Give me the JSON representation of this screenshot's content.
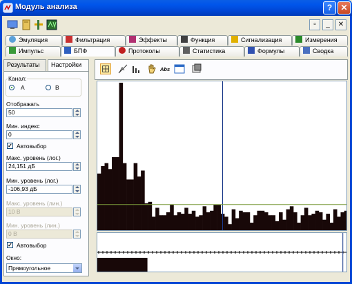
{
  "window": {
    "title": "Модуль анализа",
    "help_label": "?",
    "close_label": "✕"
  },
  "toolbar": {
    "icons": [
      "monitor-icon",
      "book-icon",
      "tools-icon",
      "av-icon"
    ],
    "controls": [
      "restore",
      "minimize",
      "close"
    ]
  },
  "tabs_row1": [
    {
      "label": "Эмуляция",
      "icon": "emulation-icon"
    },
    {
      "label": "Фильтрация",
      "icon": "filter-icon"
    },
    {
      "label": "Эффекты",
      "icon": "effects-icon"
    },
    {
      "label": "Функция",
      "icon": "function-icon"
    },
    {
      "label": "Сигнализация",
      "icon": "signal-icon"
    },
    {
      "label": "Измерения",
      "icon": "measure-icon"
    }
  ],
  "tabs_row2": [
    {
      "label": "Импульс",
      "icon": "impulse-icon"
    },
    {
      "label": "БПФ",
      "icon": "fft-icon",
      "active": true
    },
    {
      "label": "Протоколы",
      "icon": "protocol-icon"
    },
    {
      "label": "Статистика",
      "icon": "stats-icon"
    },
    {
      "label": "Формулы",
      "icon": "formula-icon"
    },
    {
      "label": "Сводка",
      "icon": "summary-icon"
    }
  ],
  "panel": {
    "tab_results": "Результаты",
    "tab_settings": "Настройки",
    "channel_label": "Канал:",
    "channel_a": "A",
    "channel_b": "B",
    "display_label": "Отображать",
    "display_value": "50",
    "min_index_label": "Мин. индекс",
    "min_index_value": "0",
    "auto_select_1": "Автовыбор",
    "max_level_log_label": "Макс. уровень (лог.)",
    "max_level_log_value": "24,151 дБ",
    "min_level_log_label": "Мин. уровень (лог.)",
    "min_level_log_value": "-106,93 дБ",
    "max_level_lin_label": "Макс. уровень (лин.)",
    "max_level_lin_value": "10 В",
    "min_level_lin_label": "Мин. уровень (лин.)",
    "min_level_lin_value": "0 В",
    "auto_select_2": "Автовыбор",
    "window_label": "Окно:",
    "window_value": "Прямоугольное"
  },
  "chart_tools": [
    "grid-icon",
    "pen-icon",
    "bars-icon",
    "hand-icon",
    "abs-icon",
    "table-icon",
    "export-icon"
  ],
  "chart_tools_abs": "Abs",
  "chart_data": {
    "type": "bar",
    "title": "",
    "xlabel": "",
    "ylabel": "",
    "ylim": [
      0,
      1
    ],
    "values": [
      0.39,
      0.44,
      0.46,
      0.42,
      0.5,
      0.5,
      1.0,
      0.46,
      0.35,
      0.35,
      0.46,
      0.37,
      0.41,
      0.19,
      0.2,
      0.1,
      0.16,
      0.11,
      0.11,
      0.13,
      0.18,
      0.11,
      0.13,
      0.12,
      0.16,
      0.12,
      0.14,
      0.1,
      0.11,
      0.17,
      0.13,
      0.14,
      0.18,
      0.18,
      0.12,
      0.1,
      0.05,
      0.15,
      0.09,
      0.14,
      0.13,
      0.13,
      0.06,
      0.11,
      0.14,
      0.14,
      0.13,
      0.11,
      0.11,
      0.07,
      0.13,
      0.08,
      0.15,
      0.17,
      0.13,
      0.06,
      0.11,
      0.16,
      0.11,
      0.12,
      0.14,
      0.13,
      0.08,
      0.12,
      0.06,
      0.15,
      0.1,
      0.13,
      0.14
    ],
    "cursor_x_fraction": 0.5,
    "cursor_y_fraction": 0.18,
    "overview_fill_fraction": 0.2,
    "overview_cursor_fraction": 0.98
  }
}
